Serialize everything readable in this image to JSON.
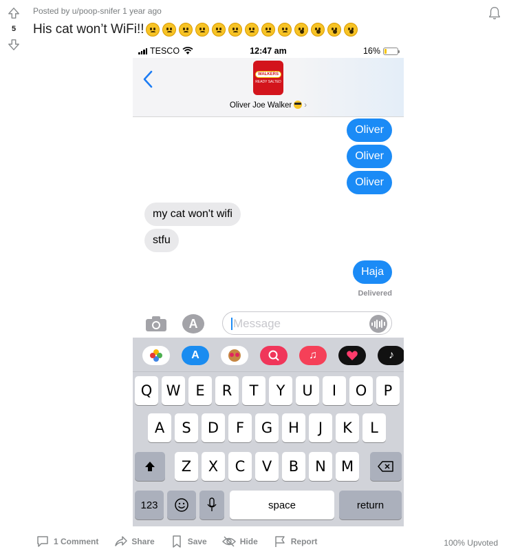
{
  "post": {
    "meta": "Posted by u/poop-snifer 1 year ago",
    "vote_count": "5",
    "title": "His cat won’t WiFi!!",
    "title_emojis": [
      "slight-frown",
      "frown",
      "tired",
      "tired",
      "tired",
      "confounded",
      "confounded",
      "confounded",
      "yawning",
      "open-mouth",
      "hushed",
      "hushed",
      "hushed"
    ]
  },
  "phone": {
    "status": {
      "carrier": "TESCO",
      "time": "12:47 am",
      "battery": "16%",
      "battery_level": 0.16
    },
    "header": {
      "contact_name": "Oliver Joe Walker",
      "avatar_logo": "WALKERS",
      "avatar_sub": "READY SALTED"
    },
    "messages": [
      {
        "dir": "sent",
        "text": "Oliver"
      },
      {
        "dir": "sent",
        "text": "Oliver"
      },
      {
        "dir": "sent",
        "text": "Oliver"
      },
      {
        "dir": "received",
        "text": "my cat won't wifi"
      },
      {
        "dir": "received",
        "text": "stfu"
      },
      {
        "dir": "sent",
        "text": "Haja"
      }
    ],
    "delivered": "Delivered",
    "input_placeholder": "Message",
    "apps": [
      "photos-icon",
      "app-store-icon",
      "memoji-icon",
      "search-images-icon",
      "music-icon",
      "heart-icon",
      "tiktok-icon"
    ],
    "keyboard": {
      "row1": [
        "Q",
        "W",
        "E",
        "R",
        "T",
        "Y",
        "U",
        "I",
        "O",
        "P"
      ],
      "row2": [
        "A",
        "S",
        "D",
        "F",
        "G",
        "H",
        "J",
        "K",
        "L"
      ],
      "row3": [
        "Z",
        "X",
        "C",
        "V",
        "B",
        "N",
        "M"
      ],
      "numbers": "123",
      "space": "space",
      "return": "return"
    }
  },
  "footer": {
    "comments": "1 Comment",
    "share": "Share",
    "save": "Save",
    "hide": "Hide",
    "report": "Report",
    "upvoted": "100% Upvoted"
  }
}
